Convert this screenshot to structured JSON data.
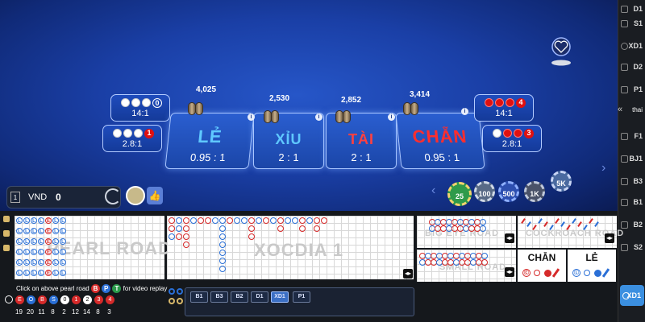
{
  "bets": {
    "le": {
      "name": "LẺ",
      "odds": "0.95 : 1",
      "amount": "4,025"
    },
    "xiu": {
      "name": "XỈU",
      "odds": "2 : 1",
      "amount": "2,530"
    },
    "tai": {
      "name": "TÀI",
      "odds": "2 : 1",
      "amount": "2,852"
    },
    "chan": {
      "name": "CHẴN",
      "odds": "0.95 : 1",
      "amount": "3,414"
    }
  },
  "side_bets": {
    "left_top": {
      "odds": "14:1",
      "count": "0"
    },
    "left_bottom": {
      "odds": "2.8:1",
      "count": "1"
    },
    "right_top": {
      "odds": "14:1",
      "count": "4"
    },
    "right_bottom": {
      "odds": "2.8:1",
      "count": "3"
    }
  },
  "balance": {
    "badge": "1",
    "currency": "VND",
    "value": "0"
  },
  "chips": [
    "25",
    "100",
    "500",
    "1K",
    "5K"
  ],
  "dealer_label": "thai",
  "sidebar": {
    "items": [
      "D1",
      "S1",
      "XD1",
      "D2",
      "P1",
      "F1",
      "BJ1",
      "B3",
      "B1",
      "B2",
      "S2",
      "XD1"
    ]
  },
  "roads": {
    "pearl_label": "PEARL ROAD",
    "xocdia_label": "XOCDIA 1",
    "big_label": "BIG EYE ROAD",
    "cockroach_label": "COCKROACH ROAD",
    "small_label": "SMALL ROAD",
    "pearl_beads_col1": [
      "Ⓛ",
      "Ⓛ",
      "Ⓛ",
      "Ⓛ",
      "Ⓛ",
      "Ⓛ"
    ]
  },
  "predict": {
    "chan": "CHẴN",
    "le": "LẺ"
  },
  "replay": {
    "text_prefix": "Click on above pearl road",
    "badges": [
      "B",
      "P",
      "T"
    ],
    "text_suffix": "for video replay"
  },
  "stats": {
    "icons": [
      "E",
      "O",
      "B",
      "S",
      "0",
      "1",
      "2",
      "3",
      "4"
    ],
    "values": [
      "19",
      "20",
      "11",
      "8",
      "2",
      "12",
      "14",
      "8",
      "3"
    ]
  },
  "tables": [
    "B1",
    "B3",
    "B2",
    "D1",
    "XD1",
    "P1"
  ]
}
